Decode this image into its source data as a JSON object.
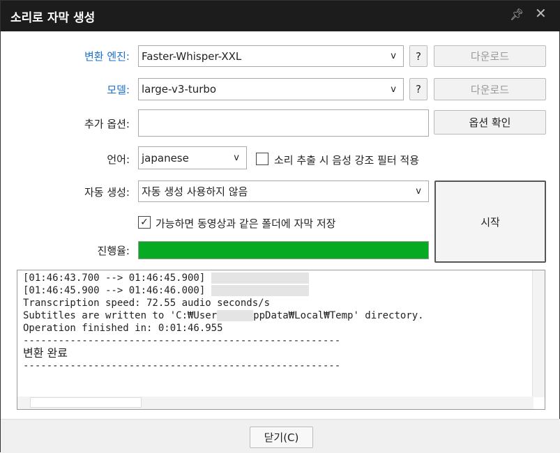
{
  "window": {
    "title": "소리로 자막 생성",
    "pin_icon": "pin-icon",
    "close_icon": "close-icon"
  },
  "form": {
    "engine": {
      "label": "변환 엔진:",
      "value": "Faster-Whisper-XXL",
      "help": "?",
      "download": "다운로드"
    },
    "model": {
      "label": "모델:",
      "value": "large-v3-turbo",
      "help": "?",
      "download": "다운로드"
    },
    "options": {
      "label": "추가 옵션:",
      "value": "",
      "confirm": "옵션 확인"
    },
    "language": {
      "label": "언어:",
      "value": "japanese",
      "filter_label": "소리 추출 시 음성 강조 필터 적용",
      "filter_checked": false
    },
    "auto": {
      "label": "자동 생성:",
      "value": "자동 생성 사용하지 않음"
    },
    "save_same_folder": {
      "label": "가능하면 동영상과 같은 폴더에 자막 저장",
      "checked": true
    },
    "progress": {
      "label": "진행율:",
      "percent": 100,
      "color": "#06ab23"
    },
    "start": "시작"
  },
  "log": {
    "line1": "[01:46:43.700 --> 01:46:45.900] ",
    "line2": "[01:46:45.900 --> 01:46:46.000] ",
    "line3": "Transcription speed: 72.55 audio seconds/s",
    "line4a": "Subtitles are written to 'C:₩User",
    "line4b": "ppData₩Local₩Temp' directory.",
    "line5": "Operation finished in: 0:01:46.955",
    "sep": "------------------------------------------------------",
    "done": "변환 완료"
  },
  "footer": {
    "close": "닫기(C)"
  }
}
